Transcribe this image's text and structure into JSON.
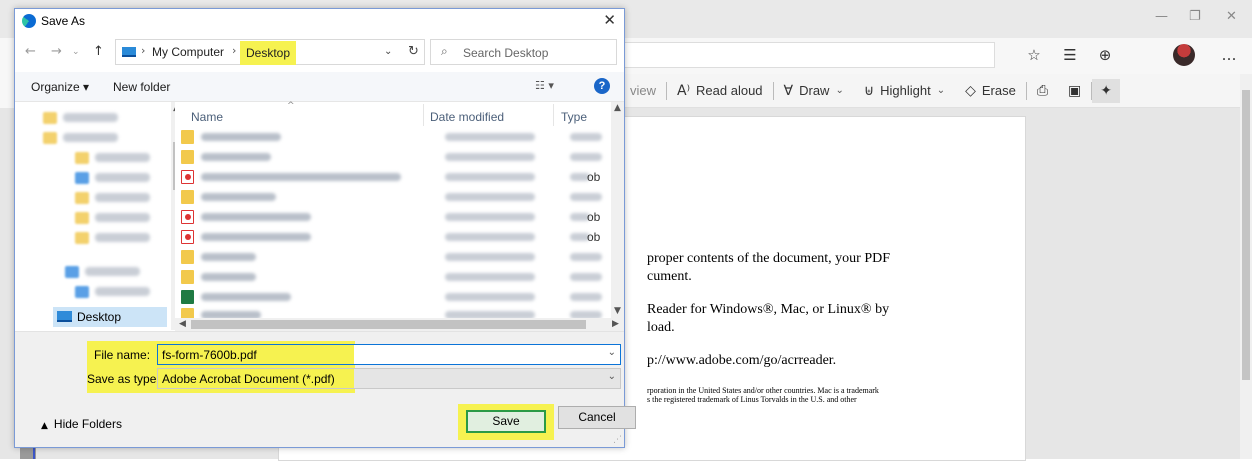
{
  "browser": {
    "window_controls": {
      "minimize": "—",
      "restore": "❐",
      "close": "✕"
    },
    "address_icons": [
      "☆",
      "☰",
      "⊕",
      "…"
    ],
    "pdf_toolbar": {
      "view_partial": "view",
      "read_aloud": "Read aloud",
      "draw": "Draw",
      "highlight": "Highlight",
      "erase": "Erase"
    },
    "pdf_lines": {
      "l1": "proper contents of the document, your PDF",
      "l2": "cument.",
      "l3": "Reader for Windows®, Mac, or Linux® by",
      "l4": "load.",
      "l5": "p://www.adobe.com/go/acrreader.",
      "l6": "rporation in the United States and/or other countries. Mac is a trademark",
      "l7": "s the registered trademark of Linus Torvalds in the U.S. and other"
    }
  },
  "dialog": {
    "title": "Save As",
    "close": "✕",
    "breadcrumb": {
      "root": "My Computer",
      "current": "Desktop"
    },
    "search_placeholder": "Search Desktop",
    "organize": "Organize ▾",
    "new_folder": "New folder",
    "columns": {
      "name": "Name",
      "date_modified": "Date modified",
      "type": "Type"
    },
    "truncated_type": "ob",
    "nav_selected": "Desktop",
    "file_name_label": "File name:",
    "file_name_value": "fs-form-7600b.pdf",
    "save_as_type_label": "Save as type:",
    "save_as_type_value": "Adobe Acrobat Document (*.pdf)",
    "hide_folders": "Hide Folders",
    "save": "Save",
    "cancel": "Cancel"
  },
  "colors": {
    "highlight": "#f6f250",
    "accent_blue": "#0b74d8",
    "save_border": "#2b9a46"
  }
}
